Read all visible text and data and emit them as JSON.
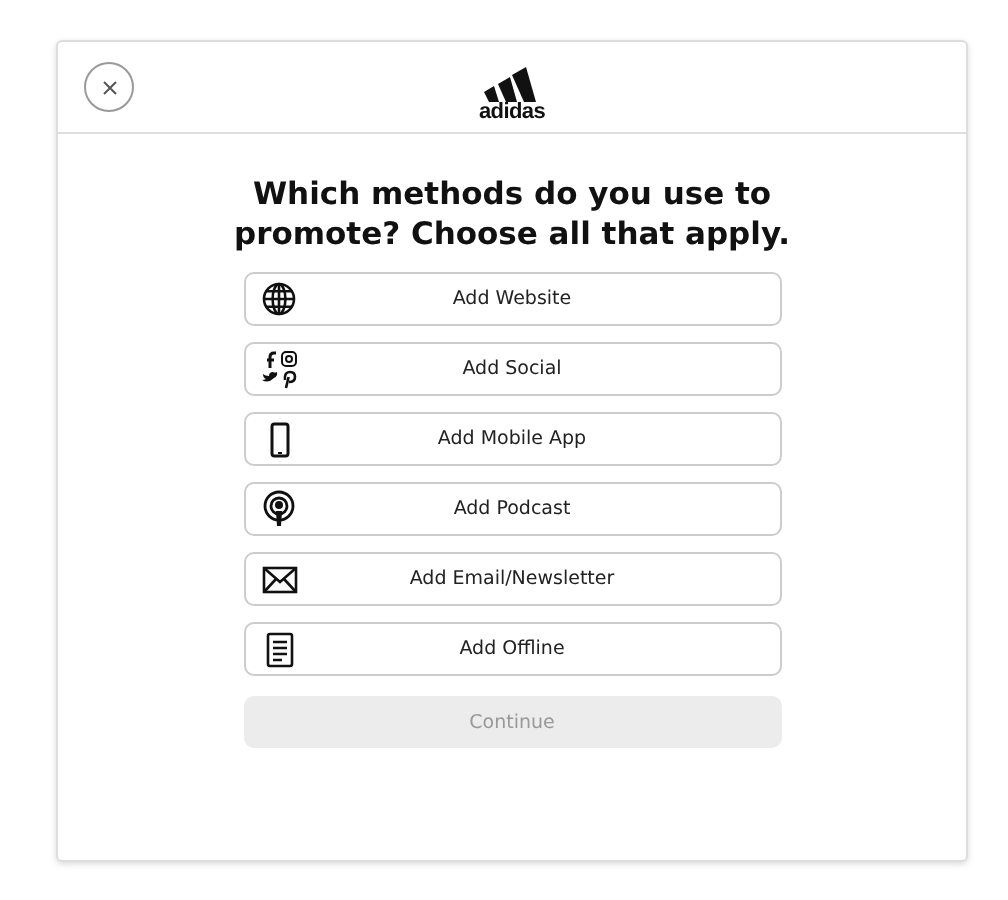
{
  "header": {
    "logo_text": "adidas"
  },
  "question": "Which methods do you use to promote? Choose all that apply.",
  "options": [
    {
      "kind": "website",
      "label": "Add Website"
    },
    {
      "kind": "social",
      "label": "Add Social"
    },
    {
      "kind": "mobile",
      "label": "Add Mobile App"
    },
    {
      "kind": "podcast",
      "label": "Add Podcast"
    },
    {
      "kind": "email",
      "label": "Add Email/Newsletter"
    },
    {
      "kind": "offline",
      "label": "Add Offline"
    }
  ],
  "continue_button": {
    "label": "Continue",
    "disabled": true
  }
}
